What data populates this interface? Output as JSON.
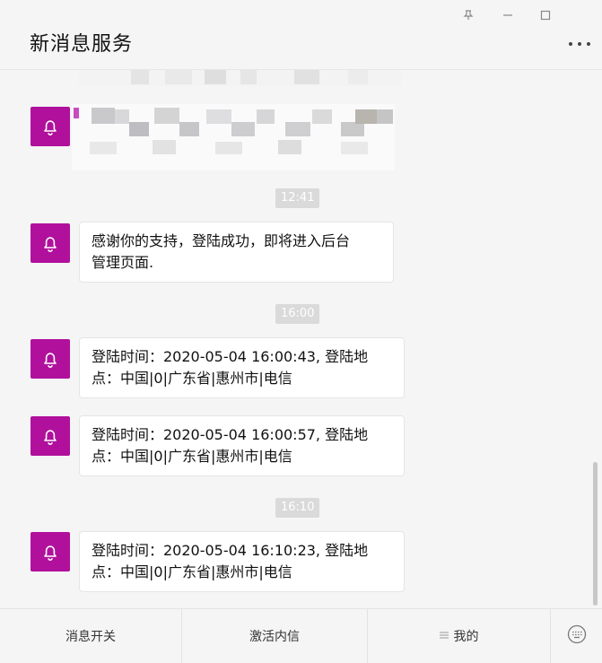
{
  "window": {
    "title": "新消息服务",
    "controls": [
      "pin-icon",
      "minimize-icon",
      "maximize-icon"
    ],
    "more_icon": "more-dots-icon"
  },
  "accent_color": "#b0109c",
  "messages": [
    {
      "type": "blurred",
      "content": "pixelated-redacted-message"
    },
    {
      "type": "time",
      "text": "12:41"
    },
    {
      "type": "message",
      "icon": "bell-icon",
      "lines": [
        "感谢你的支持，登陆成功，即将进入后台",
        "管理页面."
      ]
    },
    {
      "type": "time",
      "text": "16:00"
    },
    {
      "type": "message",
      "icon": "bell-icon",
      "lines": [
        "登陆时间：2020-05-04 16:00:43, 登陆地",
        "点：中国|0|广东省|惠州市|电信"
      ]
    },
    {
      "type": "message",
      "icon": "bell-icon",
      "lines": [
        "登陆时间：2020-05-04 16:00:57, 登陆地",
        "点：中国|0|广东省|惠州市|电信"
      ]
    },
    {
      "type": "time",
      "text": "16:10"
    },
    {
      "type": "message",
      "icon": "bell-icon",
      "lines": [
        "登陆时间：2020-05-04 16:10:23, 登陆地",
        "点：中国|0|广东省|惠州市|电信"
      ]
    }
  ],
  "bottom_menu": {
    "items": [
      {
        "label": "消息开关"
      },
      {
        "label": "激活内信"
      },
      {
        "label": "我的",
        "icon": "menu-lines-icon"
      }
    ],
    "keyboard_icon": "keyboard-icon"
  }
}
